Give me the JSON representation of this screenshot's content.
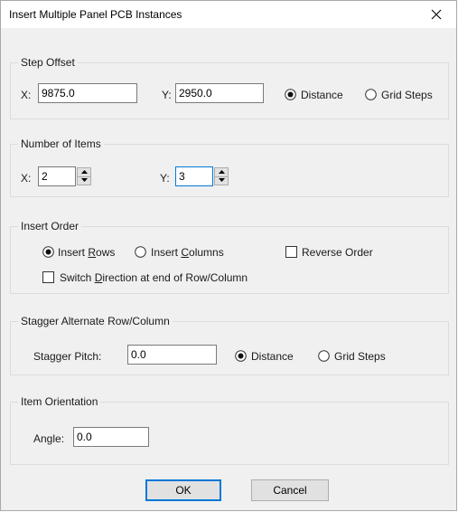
{
  "dialog": {
    "title": "Insert Multiple Panel PCB Instances"
  },
  "step_offset": {
    "group_label": "Step Offset",
    "x_label": "X:",
    "x_value": "9875.0",
    "y_label": "Y:",
    "y_value": "2950.0",
    "distance_label": "Distance",
    "grid_steps_label": "Grid Steps",
    "selected": "Distance"
  },
  "number_of_items": {
    "group_label": "Number of Items",
    "x_label": "X:",
    "x_value": "2",
    "y_label": "Y:",
    "y_value": "3"
  },
  "insert_order": {
    "group_label": "Insert Order",
    "insert_rows": {
      "pre": "Insert ",
      "accel": "R",
      "post": "ows"
    },
    "insert_columns": {
      "pre": "Insert ",
      "accel": "C",
      "post": "olumns"
    },
    "selected": "Insert Rows",
    "reverse_order_label": "Reverse Order",
    "reverse_order_checked": false,
    "switch_direction": {
      "pre": "Switch ",
      "accel": "D",
      "post": "irection at end of Row/Column"
    },
    "switch_direction_checked": false
  },
  "stagger": {
    "group_label": "Stagger Alternate Row/Column",
    "pitch_label": "Stagger Pitch:",
    "pitch_value": "0.0",
    "distance_label": "Distance",
    "grid_steps_label": "Grid Steps",
    "selected": "Distance"
  },
  "orientation": {
    "group_label": "Item Orientation",
    "angle_label": "Angle:",
    "angle_value": "0.0"
  },
  "buttons": {
    "ok": "OK",
    "cancel": "Cancel"
  },
  "icons": {
    "close": "close-icon",
    "spin_up": "chevron-up-icon",
    "spin_down": "chevron-down-icon"
  },
  "colors": {
    "focus": "#0078d7",
    "dialog_bg": "#f0f0f0"
  }
}
